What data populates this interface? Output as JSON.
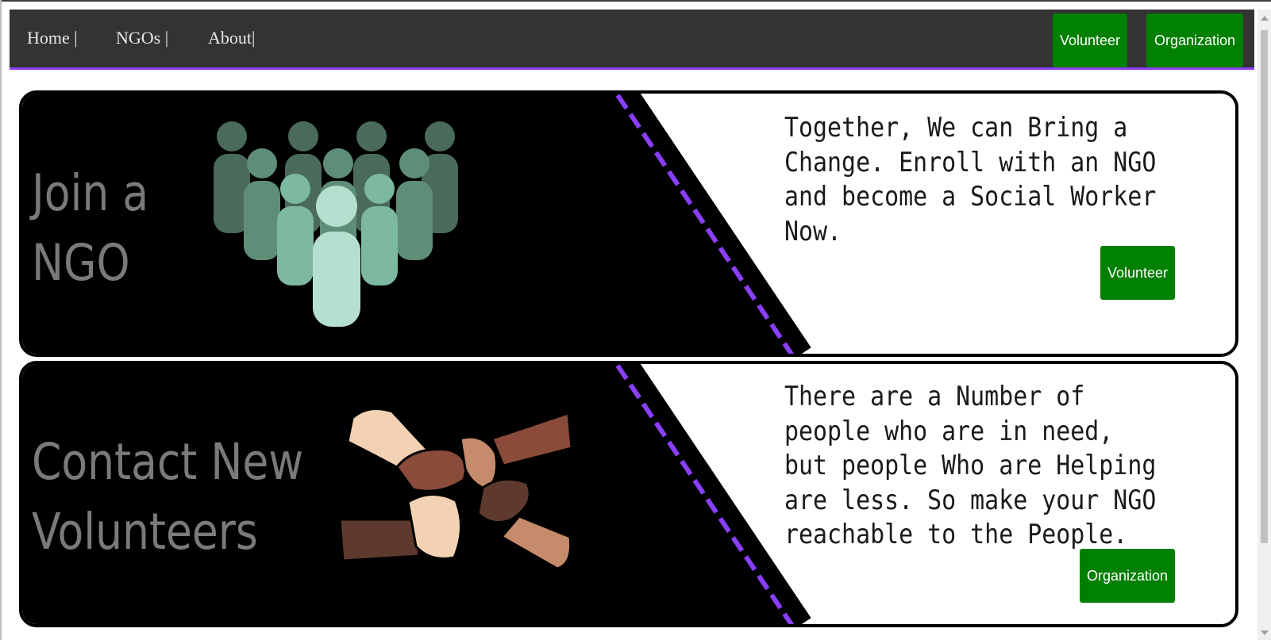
{
  "nav": {
    "links": [
      "Home |",
      "NGOs |",
      "About|"
    ],
    "buttons": {
      "volunteer": "Volunteer",
      "organization": "Organization"
    }
  },
  "banners": [
    {
      "headline_line1": "Join a",
      "headline_line2": "NGO",
      "text": "Together, We can Bring a\nChange. Enroll with an NGO\nand become a Social Worker\nNow.",
      "button": "Volunteer",
      "illustration": "people-group-icon"
    },
    {
      "headline_line1": "Contact New",
      "headline_line2": "Volunteers",
      "text": "There are a Number of\npeople who are in need,\nbut people Who are Helping\nare less. So make your NGO\nreachable to the People.",
      "button": "Organization",
      "illustration": "joined-hands-icon"
    }
  ],
  "colors": {
    "navbar_bg": "#333333",
    "accent_purple": "#8a3ffc",
    "button_green": "#008000",
    "banner_dark": "#000000",
    "headline_gray": "#7a7a7a"
  }
}
